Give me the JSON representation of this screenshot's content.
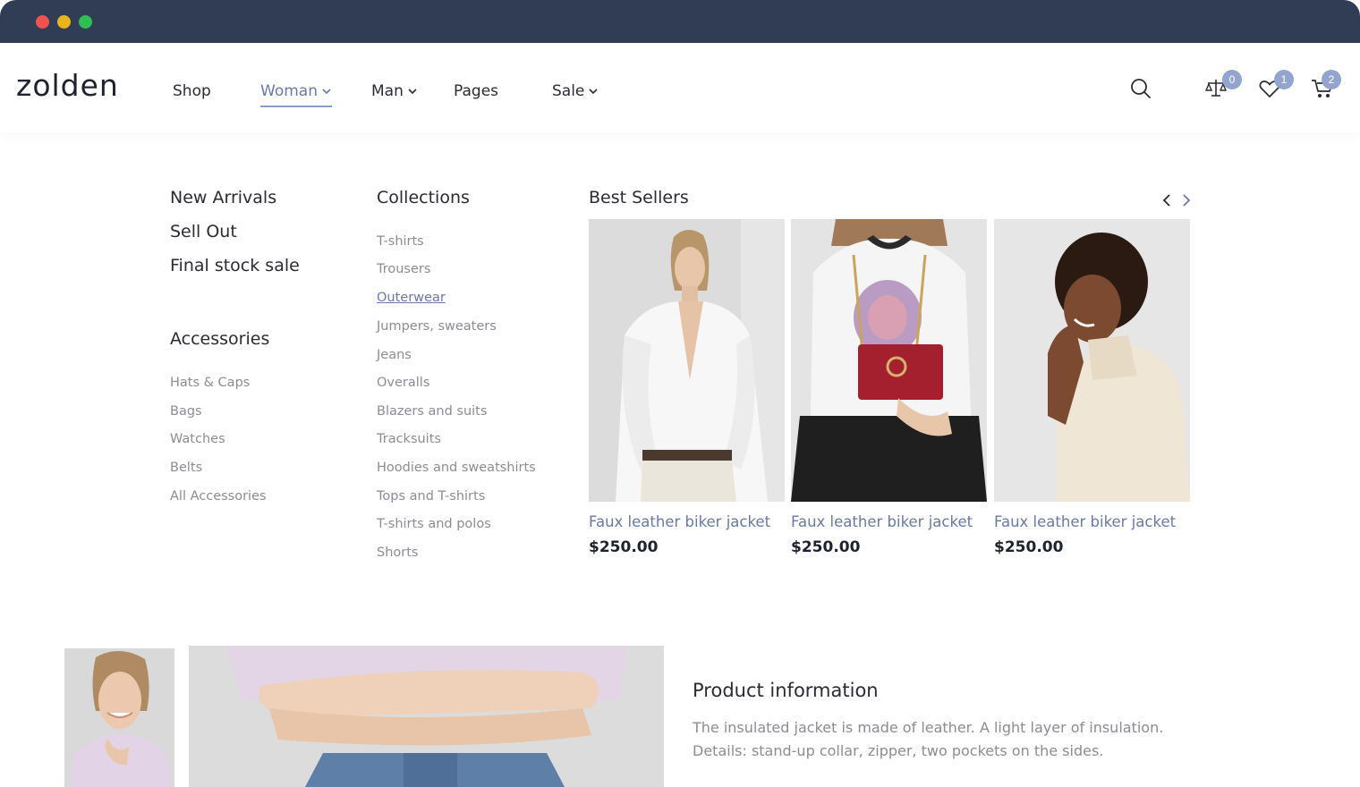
{
  "header": {
    "logo": "zolden",
    "nav": [
      {
        "label": "Shop"
      },
      {
        "label": "Woman"
      },
      {
        "label": "Man"
      },
      {
        "label": "Pages"
      },
      {
        "label": "Sale"
      }
    ],
    "badges": {
      "compare": "0",
      "wishlist": "1",
      "cart": "2"
    }
  },
  "menu": {
    "featured": [
      "New Arrivals",
      "Sell Out",
      "Final stock sale"
    ],
    "accessories_title": "Accessories",
    "accessories": [
      "Hats & Caps",
      "Bags",
      "Watches",
      "Belts",
      "All Accessories"
    ],
    "collections_title": "Collections",
    "collections": [
      "T-shirts",
      "Trousers",
      "Outerwear",
      "Jumpers, sweaters",
      "Jeans",
      "Overalls",
      "Blazers and suits",
      "Tracksuits",
      "Hoodies and sweatshirts",
      "Tops and T-shirts",
      "T-shirts and polos",
      "Shorts"
    ],
    "best_sellers_title": "Best Sellers",
    "products": [
      {
        "name": "Faux leather biker jacket",
        "price": "$250.00"
      },
      {
        "name": "Faux leather biker jacket",
        "price": "$250.00"
      },
      {
        "name": "Faux leather biker jacket",
        "price": "$250.00"
      }
    ]
  },
  "product_info": {
    "title": "Product information",
    "line1": "The insulated jacket is made of leather. A light layer of insulation.",
    "line2": "Details: stand-up collar, zipper, two pockets on the sides."
  },
  "colors": {
    "accent": "#6a79a8",
    "badge": "#93a4cf",
    "titlebar": "#313c55"
  }
}
